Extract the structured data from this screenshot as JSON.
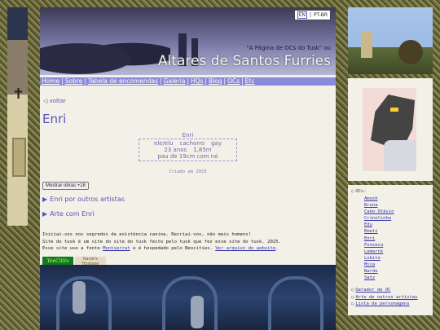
{
  "lang": {
    "en": "EN",
    "sep": "|",
    "pt": "PT-BR"
  },
  "banner": {
    "subtitle": "\"A Página de OCs do Tusk\" ou",
    "title": "Altares de Santos Furries"
  },
  "nav": [
    "Home",
    "Sobre",
    "Tabela de encomendas",
    "Galeria",
    "HQs",
    "Blog",
    "OCs",
    "Etc"
  ],
  "back": "◁ voltar",
  "heading": "Enri",
  "profile": {
    "name": "Enri",
    "pronouns": "ele/elu",
    "species": "cachorro",
    "orientation": "gay",
    "age": "23 anos",
    "height": "1,85m",
    "extra": "pau de 19cm com nó",
    "created": "Criado em 2025"
  },
  "show_button": "Mostrar obras +18",
  "details": [
    "Enri por outros artistas",
    "Arte com Enri"
  ],
  "para": {
    "line1": "Iniciai-vos nos segredos da existência canina. Recriai-vos, não mais homens!",
    "line2": "Site do tusk é um site do site do tusk feito pelo tusk que fez esse site do tusk. 2025.",
    "line3_a": "Esse site use a fonte ",
    "line3_font": "Montserrat",
    "line3_b": " e é hospedado pelo Neocities. ",
    "line3_archive": "Ver arquivo do website",
    "line3_end": "."
  },
  "badges": {
    "one": "YeeCitiiv",
    "two": "Kavie's Hostage"
  },
  "sidebar": {
    "ocs": "OCs:",
    "characters": [
      "Amosh",
      "Bruna",
      "Cabo Otávio",
      "Crinolinha",
      "Edu",
      "Emeti",
      "Enri",
      "Fonseca",
      "Lamarck",
      "Lobito",
      "Mica",
      "Nardo",
      "Satz"
    ],
    "links": [
      "Gerador de OC",
      "Arte de outros artistas",
      "Lista de personagens"
    ]
  },
  "colors": {
    "accent": "#5555bb",
    "nav": "#8a8ad8",
    "panel": "#f3f0e7"
  }
}
